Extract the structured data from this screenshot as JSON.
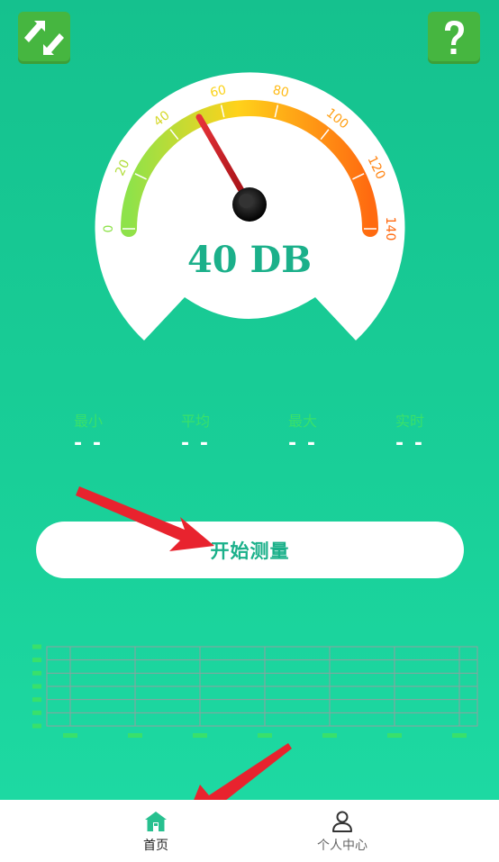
{
  "colors": {
    "background_top": "#15c18e",
    "background_bottom": "#1edba4",
    "accent": "#1bb08a",
    "icon_button": "#46b640",
    "stat_label": "#39e06b",
    "arrow": "#e8232e"
  },
  "toolbar": {
    "refresh_icon": "refresh-arrows-icon",
    "help_icon": "question-mark-icon"
  },
  "gauge": {
    "reading_text": "40 DB",
    "current_value": 40,
    "min": 0,
    "max": 140,
    "ticks": [
      "0",
      "20",
      "40",
      "60",
      "80",
      "100",
      "120",
      "140"
    ]
  },
  "stats": {
    "min": {
      "label": "最小",
      "value": "- -"
    },
    "avg": {
      "label": "平均",
      "value": "- -"
    },
    "max": {
      "label": "最大",
      "value": "- -"
    },
    "realtime": {
      "label": "实时",
      "value": "- -"
    }
  },
  "start_button": {
    "label": "开始测量"
  },
  "nav": {
    "home": {
      "label": "首页",
      "icon": "house-icon",
      "active": true
    },
    "profile": {
      "label": "个人中心",
      "icon": "person-icon",
      "active": false
    }
  }
}
